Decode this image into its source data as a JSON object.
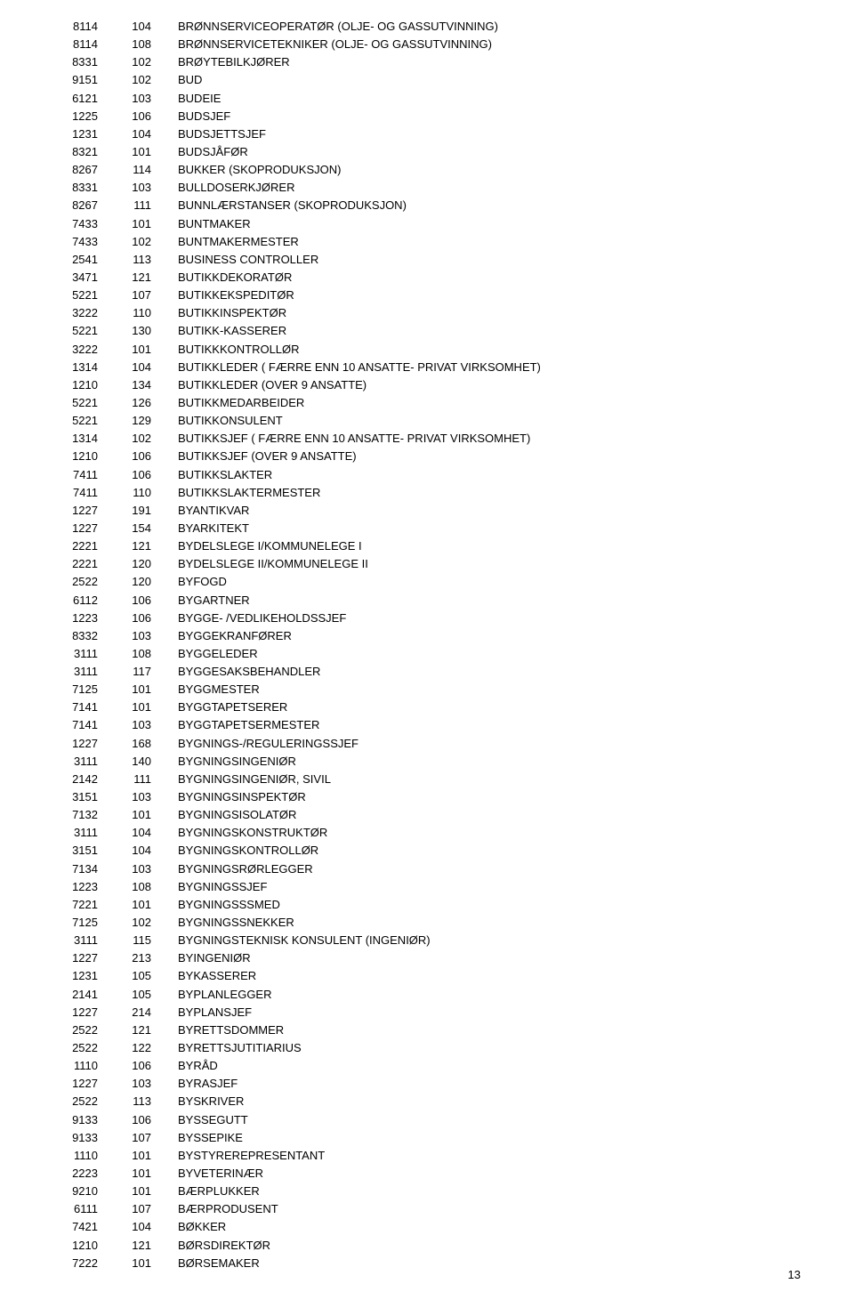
{
  "page": {
    "number": "13",
    "rows": [
      {
        "code": "8114",
        "num": "104",
        "title": "BRØNNSERVICEOPERATØR (OLJE- OG GASSUTVINNING)"
      },
      {
        "code": "8114",
        "num": "108",
        "title": "BRØNNSERVICETEKNIKER (OLJE- OG GASSUTVINNING)"
      },
      {
        "code": "8331",
        "num": "102",
        "title": "BRØYTEBILKJØRER"
      },
      {
        "code": "9151",
        "num": "102",
        "title": "BUD"
      },
      {
        "code": "6121",
        "num": "103",
        "title": "BUDEIE"
      },
      {
        "code": "1225",
        "num": "106",
        "title": "BUDSJEF"
      },
      {
        "code": "1231",
        "num": "104",
        "title": "BUDSJETTSJEF"
      },
      {
        "code": "8321",
        "num": "101",
        "title": "BUDSJÅFØR"
      },
      {
        "code": "8267",
        "num": "114",
        "title": "BUKKER (SKOPRODUKSJON)"
      },
      {
        "code": "8331",
        "num": "103",
        "title": "BULLDOSERKJØRER"
      },
      {
        "code": "8267",
        "num": "111",
        "title": "BUNNLÆRSTANSER (SKOPRODUKSJON)"
      },
      {
        "code": "7433",
        "num": "101",
        "title": "BUNTMAKER"
      },
      {
        "code": "7433",
        "num": "102",
        "title": "BUNTMAKERMESTER"
      },
      {
        "code": "2541",
        "num": "113",
        "title": "BUSINESS CONTROLLER"
      },
      {
        "code": "3471",
        "num": "121",
        "title": "BUTIKKDEKORATØR"
      },
      {
        "code": "5221",
        "num": "107",
        "title": "BUTIKKEKSPEDITØR"
      },
      {
        "code": "3222",
        "num": "110",
        "title": "BUTIKKINSPEKTØR"
      },
      {
        "code": "5221",
        "num": "130",
        "title": "BUTIKK-KASSERER"
      },
      {
        "code": "3222",
        "num": "101",
        "title": "BUTIKKKONTROLLØR"
      },
      {
        "code": "1314",
        "num": "104",
        "title": "BUTIKKLEDER ( FÆRRE ENN 10 ANSATTE- PRIVAT VIRKSOMHET)"
      },
      {
        "code": "1210",
        "num": "134",
        "title": "BUTIKKLEDER (OVER 9 ANSATTE)"
      },
      {
        "code": "5221",
        "num": "126",
        "title": "BUTIKKMEDARBEIDER"
      },
      {
        "code": "5221",
        "num": "129",
        "title": "BUTIKKONSULENT"
      },
      {
        "code": "1314",
        "num": "102",
        "title": "BUTIKKSJEF ( FÆRRE ENN 10 ANSATTE- PRIVAT VIRKSOMHET)"
      },
      {
        "code": "1210",
        "num": "106",
        "title": "BUTIKKSJEF (OVER 9 ANSATTE)"
      },
      {
        "code": "7411",
        "num": "106",
        "title": "BUTIKKSLAKTER"
      },
      {
        "code": "7411",
        "num": "110",
        "title": "BUTIKKSLAKTERMESTER"
      },
      {
        "code": "1227",
        "num": "191",
        "title": "BYANTIKVAR"
      },
      {
        "code": "1227",
        "num": "154",
        "title": "BYARKITEKT"
      },
      {
        "code": "2221",
        "num": "121",
        "title": "BYDELSLEGE I/KOMMUNELEGE I"
      },
      {
        "code": "2221",
        "num": "120",
        "title": "BYDELSLEGE II/KOMMUNELEGE II"
      },
      {
        "code": "2522",
        "num": "120",
        "title": "BYFOGD"
      },
      {
        "code": "6112",
        "num": "106",
        "title": "BYGARTNER"
      },
      {
        "code": "1223",
        "num": "106",
        "title": "BYGGE- /VEDLIKEHOLDSSJEF"
      },
      {
        "code": "8332",
        "num": "103",
        "title": "BYGGEKRANFØRER"
      },
      {
        "code": "3111",
        "num": "108",
        "title": "BYGGELEDER"
      },
      {
        "code": "3111",
        "num": "117",
        "title": "BYGGESAKSBEHANDLER"
      },
      {
        "code": "7125",
        "num": "101",
        "title": "BYGGMESTER"
      },
      {
        "code": "7141",
        "num": "101",
        "title": "BYGGTAPETSERER"
      },
      {
        "code": "7141",
        "num": "103",
        "title": "BYGGTAPETSERMESTER"
      },
      {
        "code": "1227",
        "num": "168",
        "title": "BYGNINGS-/REGULERINGSSJEF"
      },
      {
        "code": "3111",
        "num": "140",
        "title": "BYGNINGSINGENIØR"
      },
      {
        "code": "2142",
        "num": "111",
        "title": "BYGNINGSINGENIØR, SIVIL"
      },
      {
        "code": "3151",
        "num": "103",
        "title": "BYGNINGSINSPEKTØR"
      },
      {
        "code": "7132",
        "num": "101",
        "title": "BYGNINGSISOLATØR"
      },
      {
        "code": "3111",
        "num": "104",
        "title": "BYGNINGSKONSTRUKTØR"
      },
      {
        "code": "3151",
        "num": "104",
        "title": "BYGNINGSKONTROLLØR"
      },
      {
        "code": "7134",
        "num": "103",
        "title": "BYGNINGSRØRLEGGER"
      },
      {
        "code": "1223",
        "num": "108",
        "title": "BYGNINGSSJEF"
      },
      {
        "code": "7221",
        "num": "101",
        "title": "BYGNINGSSSMED"
      },
      {
        "code": "7125",
        "num": "102",
        "title": "BYGNINGSSNEKKER"
      },
      {
        "code": "3111",
        "num": "115",
        "title": "BYGNINGSTEKNISK KONSULENT (INGENIØR)"
      },
      {
        "code": "1227",
        "num": "213",
        "title": "BYINGENIØR"
      },
      {
        "code": "1231",
        "num": "105",
        "title": "BYKASSERER"
      },
      {
        "code": "2141",
        "num": "105",
        "title": "BYPLANLEGGER"
      },
      {
        "code": "1227",
        "num": "214",
        "title": "BYPLANSJEF"
      },
      {
        "code": "2522",
        "num": "121",
        "title": "BYRETTSDOMMER"
      },
      {
        "code": "2522",
        "num": "122",
        "title": "BYRETTSJUTITIARIUS"
      },
      {
        "code": "1110",
        "num": "106",
        "title": "BYRÅD"
      },
      {
        "code": "1227",
        "num": "103",
        "title": "BYRASJEF"
      },
      {
        "code": "2522",
        "num": "113",
        "title": "BYSKRIVER"
      },
      {
        "code": "9133",
        "num": "106",
        "title": "BYSSEGUTT"
      },
      {
        "code": "9133",
        "num": "107",
        "title": "BYSSEPIKE"
      },
      {
        "code": "1110",
        "num": "101",
        "title": "BYSTYREREPRESENTANT"
      },
      {
        "code": "2223",
        "num": "101",
        "title": "BYVETERINÆR"
      },
      {
        "code": "9210",
        "num": "101",
        "title": "BÆRPLUKKER"
      },
      {
        "code": "6111",
        "num": "107",
        "title": "BÆRPRODUSENT"
      },
      {
        "code": "7421",
        "num": "104",
        "title": "BØKKER"
      },
      {
        "code": "1210",
        "num": "121",
        "title": "BØRSDIREKTØR"
      },
      {
        "code": "7222",
        "num": "101",
        "title": "BØRSEMAKER"
      }
    ]
  }
}
